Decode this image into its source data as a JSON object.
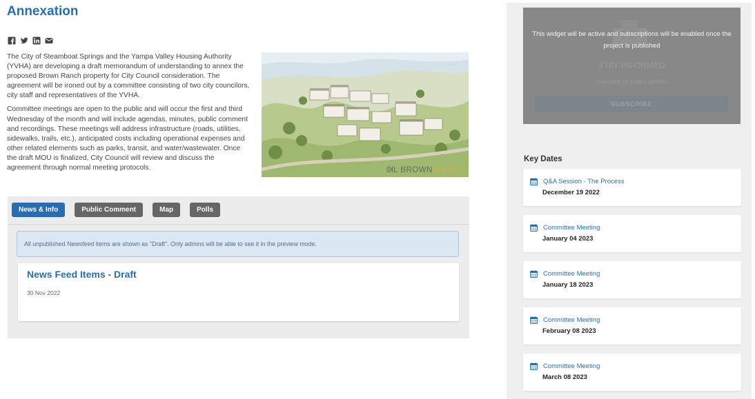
{
  "page": {
    "title": "Annexation"
  },
  "share": {
    "icons": [
      "facebook-icon",
      "twitter-icon",
      "linkedin-icon",
      "email-icon"
    ]
  },
  "intro": {
    "paragraph1": "The City of Steamboat Springs and the Yampa Valley Housing Authority (YVHA) are developing a draft memorandum of understanding to annex the proposed Brown Ranch property for City Council consideration. The agreement will be ironed out by a committee consisting of two city councilors, city staff and representatives of the YVHA.",
    "paragraph2": "Committee meetings are open to the public and will occur the first and third Wednesday of the month and will include agendas, minutes, public comment and recordings. These meetings will address infrastructure (roads, utilities, sidewalks, trails, etc.), anticipated costs including operational expenses and other related elements such as parks, transit, and water/wastewater. Once the draft MOU is finalized, City Council will review and discuss the agreement through normal meeting protocols."
  },
  "hero": {
    "logo_mark": "ᘛL",
    "caption_brown": "BROWN",
    "caption_ranch": "RANCH"
  },
  "tabs": [
    {
      "label": "News & Info",
      "active": true
    },
    {
      "label": "Public Comment",
      "active": false
    },
    {
      "label": "Map",
      "active": false
    },
    {
      "label": "Polls",
      "active": false
    }
  ],
  "alert": {
    "text": "All unpublished Newsfeed items are shown as \"Draft\". Only admins will be able to see it in the preview mode."
  },
  "news": {
    "title": "News Feed Items - Draft",
    "date": "30 Nov 2022"
  },
  "widget": {
    "message": "This widget will be active and subscriptions will be enabled once the project is published",
    "heading": "STAY INFORMED",
    "subtext": "Subscribe for project updates",
    "button": "SUBSCRIBE"
  },
  "key_dates": {
    "heading": "Key Dates",
    "items": [
      {
        "name": "Q&A Session - The Process",
        "date": "December 19 2022"
      },
      {
        "name": "Committee Meeting",
        "date": "January 04 2023"
      },
      {
        "name": "Committee Meeting",
        "date": "January 18 2023"
      },
      {
        "name": "Committee Meeting",
        "date": "February 08 2023"
      },
      {
        "name": "Committee Meeting",
        "date": "March 08 2023"
      }
    ]
  },
  "colors": {
    "primary_blue": "#2a6ea8",
    "active_tab": "#2b6bb0",
    "inactive_tab": "#666666",
    "alert_bg": "#dbe8f3",
    "widget_overlay": "#888888"
  }
}
